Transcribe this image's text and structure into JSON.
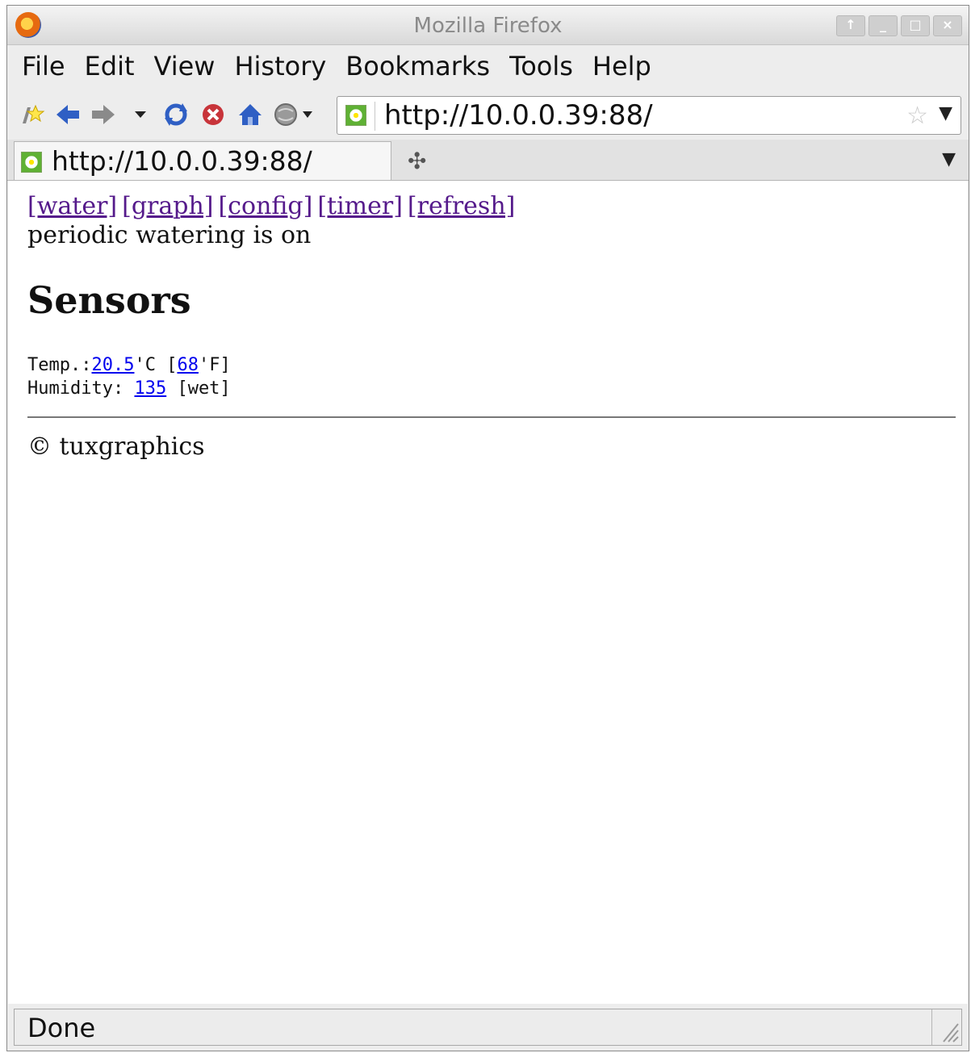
{
  "window": {
    "title": "Mozilla Firefox",
    "controls": [
      "↑",
      "_",
      "□",
      "×"
    ]
  },
  "menu": [
    "File",
    "Edit",
    "View",
    "History",
    "Bookmarks",
    "Tools",
    "Help"
  ],
  "toolbar": {
    "icons": [
      "bookmark-star-icon",
      "back-arrow-icon",
      "forward-arrow-icon",
      "history-dropdown-icon",
      "reload-icon",
      "stop-icon",
      "home-icon",
      "globe-icon"
    ]
  },
  "urlbar": {
    "url": "http://10.0.0.39:88/"
  },
  "tabs": [
    {
      "label": "http://10.0.0.39:88/"
    }
  ],
  "page": {
    "nav_links": [
      "[water]",
      "[graph]",
      "[config]",
      "[timer]",
      "[refresh]"
    ],
    "status": "periodic watering is on",
    "heading": "Sensors",
    "temp_label": "Temp.:",
    "temp_c": "20.5",
    "temp_c_unit": "'C [",
    "temp_f": "68",
    "temp_f_unit": "'F]",
    "humidity_label": "Humidity: ",
    "humidity_value": "135",
    "humidity_state": " [wet]",
    "footer": "© tuxgraphics"
  },
  "statusbar": {
    "text": "Done"
  }
}
